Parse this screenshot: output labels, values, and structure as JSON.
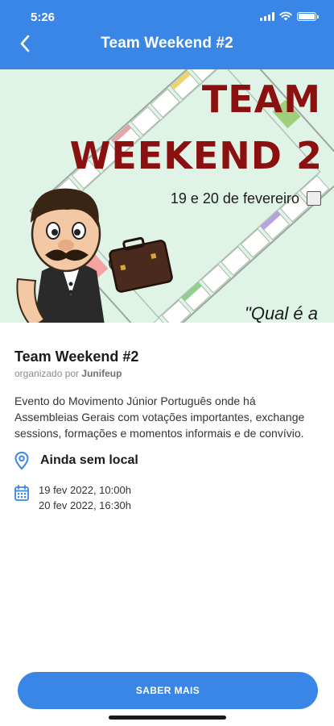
{
  "status": {
    "time": "5:26"
  },
  "header": {
    "title": "Team Weekend #2"
  },
  "banner": {
    "title_line1": "TEAM",
    "title_line2": "WEEKEND 2",
    "date": "19 e 20 de fevereiro",
    "quote": "\"Qual é a"
  },
  "event": {
    "title": "Team Weekend #2",
    "organizer_prefix": "organizado por",
    "organizer": "Junifeup",
    "description": "Evento do Movimento Júnior Português onde há Assembleias Gerais com votações importantes, exchange sessions, formações e momentos informais e de convívio.",
    "location": "Ainda sem local",
    "start": "19 fev 2022, 10:00h",
    "end": "20 fev 2022, 16:30h"
  },
  "cta": {
    "label": "SABER MAIS"
  },
  "colors": {
    "primary": "#3a86e6",
    "banner_title": "#8b1010",
    "banner_bg": "#dff3e7"
  }
}
